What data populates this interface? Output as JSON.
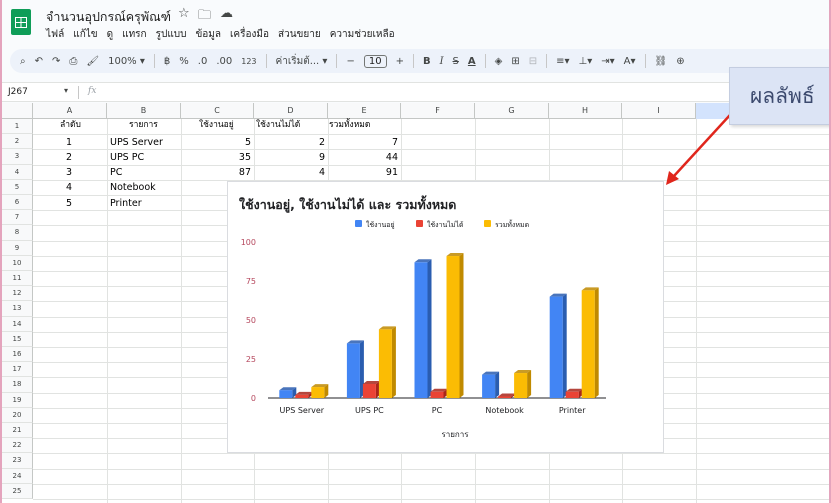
{
  "app": {
    "doc_title": "จำนวนอุปกรณ์ครุพัณฑ์",
    "menus": [
      "ไฟล์",
      "แก้ไข",
      "ดู",
      "แทรก",
      "รูปแบบ",
      "ข้อมูล",
      "เครื่องมือ",
      "ส่วนขยาย",
      "ความช่วยเหลือ"
    ]
  },
  "toolbar": {
    "zoom": "100%",
    "currency": "฿",
    "percent": "%",
    "dec_less": ".0",
    "dec_more": ".00",
    "number_format": "123",
    "font": "ค่าเริ่มต้...",
    "font_size": "10",
    "bold": "B",
    "italic": "I",
    "strike": "S",
    "text_color": "A"
  },
  "formula_bar": {
    "cell_ref": "J267",
    "fx": "fx",
    "value": ""
  },
  "columns": [
    "A",
    "B",
    "C",
    "D",
    "E",
    "F",
    "G",
    "H",
    "I"
  ],
  "rows": [
    "1",
    "2",
    "3",
    "4",
    "5",
    "6",
    "7",
    "8",
    "9",
    "10",
    "11",
    "12",
    "13",
    "14",
    "15",
    "16",
    "17",
    "18",
    "19",
    "20",
    "21",
    "22",
    "23",
    "24",
    "25"
  ],
  "table": {
    "headers": [
      "ลำดับ",
      "รายการ",
      "ใช้งานอยู่",
      "ใช้งานไม่ได้",
      "รวมทั้งหมด"
    ],
    "rows": [
      {
        "no": "1",
        "item": "UPS Server",
        "in_use": "5",
        "broken": "2",
        "total": "7"
      },
      {
        "no": "2",
        "item": "UPS PC",
        "in_use": "35",
        "broken": "9",
        "total": "44"
      },
      {
        "no": "3",
        "item": "PC",
        "in_use": "87",
        "broken": "4",
        "total": "91"
      },
      {
        "no": "4",
        "item": "Notebook",
        "in_use": "",
        "broken": "",
        "total": ""
      },
      {
        "no": "5",
        "item": "Printer",
        "in_use": "",
        "broken": "",
        "total": ""
      }
    ]
  },
  "callout": {
    "text": "ผลลัพธ์"
  },
  "colors": {
    "series1": "#4285f4",
    "series2": "#ea4335",
    "series3": "#fbbc04",
    "arrow": "#e0261c"
  },
  "chart_data": {
    "type": "bar",
    "title": "ใช้งานอยู่, ใช้งานไม่ได้ และ รวมทั้งหมด",
    "xlabel": "รายการ",
    "ylabel": "",
    "categories": [
      "UPS Server",
      "UPS PC",
      "PC",
      "Notebook",
      "Printer"
    ],
    "series": [
      {
        "name": "ใช้งานอยู่",
        "values": [
          5,
          35,
          87,
          15,
          65
        ]
      },
      {
        "name": "ใช้งานไม่ได้",
        "values": [
          2,
          9,
          4,
          1,
          4
        ]
      },
      {
        "name": "รวมทั้งหมด",
        "values": [
          7,
          44,
          91,
          16,
          69
        ]
      }
    ],
    "yticks": [
      "0",
      "25",
      "50",
      "75",
      "100"
    ],
    "ylim": [
      0,
      100
    ],
    "legend": "top",
    "grid": false,
    "bar_style": "3d"
  }
}
